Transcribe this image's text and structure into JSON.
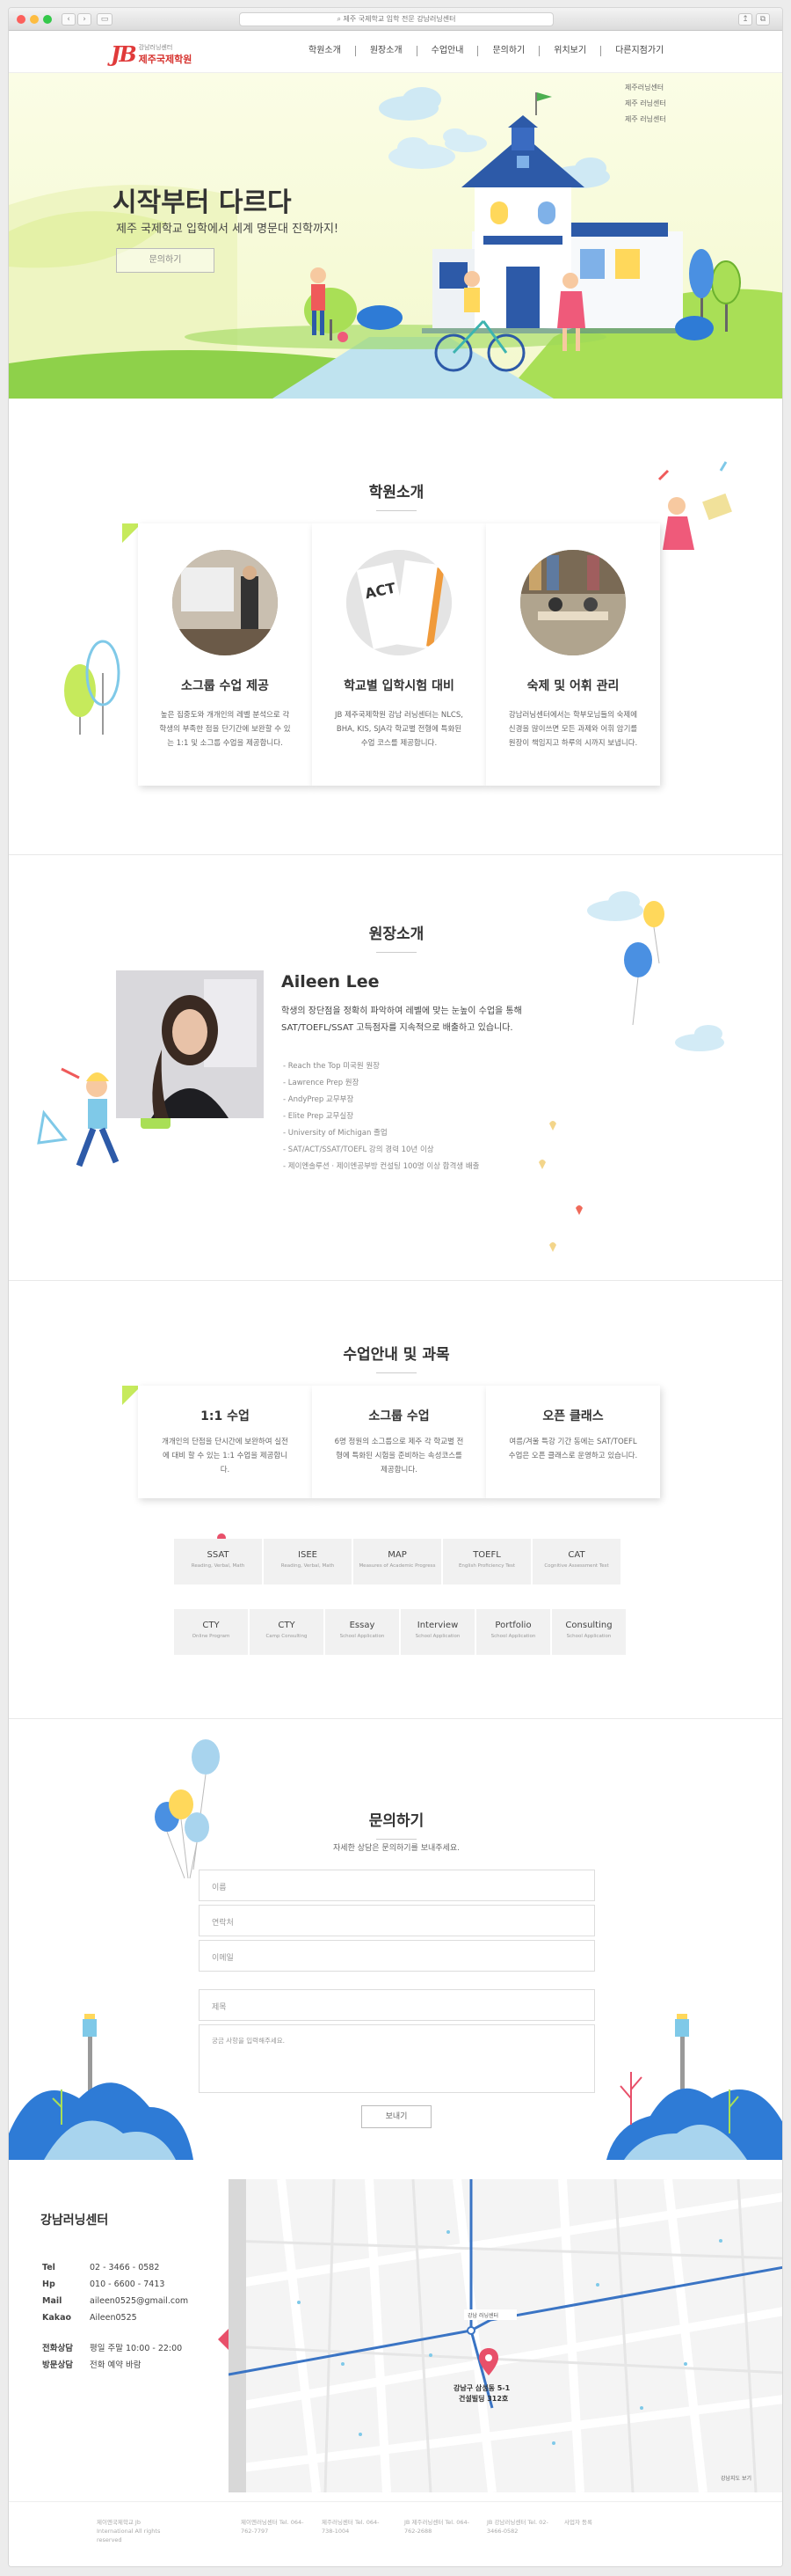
{
  "browser": {
    "address": "제주 국제학교 입학 전문 강남러닝센터"
  },
  "header": {
    "logo_mark": "JB",
    "logo_sub": "강남러닝센터",
    "logo_main": "제주국제학원",
    "nav": [
      "학원소개",
      "원장소개",
      "수업안내",
      "문의하기",
      "위치보기",
      "다른지점가기"
    ]
  },
  "hero": {
    "title": "시작부터 다르다",
    "subtitle": "제주 국제학교 입학에서 세계 명문대 진학까지!",
    "button": "문의하기",
    "side_menu": [
      "제주러닝센터",
      "제주 러닝센터",
      "제주 러닝센터"
    ]
  },
  "intro": {
    "title": "학원소개",
    "cards": [
      {
        "title": "소그룹 수업 제공",
        "desc": "높은 집중도와 개개인의 레벨 분석으로 각 학생의 부족한 점을 단기간에 보완할 수 있는 1:1 및 소그룹 수업을 제공합니다."
      },
      {
        "title": "학교별 입학시험 대비",
        "desc": "JB 제주국제학원 강남 러닝센터는 NLCS, BHA, KIS, SJA각 학교별 전형에 특화된 수업 코스를 제공합니다."
      },
      {
        "title": "숙제 및 어휘 관리",
        "desc": "강남러닝센터에서는 학부모님들의 숙제에 신경을 많이쓰면 모든 과제와 어휘 암기를 원장이 책임지고 하루의 시까지 보냅니다."
      }
    ],
    "act_card": "ACT"
  },
  "director": {
    "title": "원장소개",
    "name": "Aileen Lee",
    "intro": "학생의 장단점을 정확히 파악하여 레벨에 맞는 눈높이 수업을 통해 SAT/TOEFL/SSAT 고득점자를 지속적으로 배출하고 있습니다.",
    "career": [
      "- Reach the Top 미국원 원장",
      "- Lawrence Prep 원장",
      "- AndyPrep 교무부장",
      "- Elite Prep 교무실장",
      "- University of Michigan 졸업",
      "- SAT/ACT/SSAT/TOEFL 강의 경력 10년 이상",
      "- 제이엔솔루션 · 제이엔공부방 컨설팅 100명 이상 합격생 배출"
    ]
  },
  "classes": {
    "title": "수업안내 및 과목",
    "cards": [
      {
        "title": "1:1 수업",
        "desc": "개개인의 단점을 단시간에 보완하여 실전에 대비 할 수 있는 1:1 수업을 제공합니다."
      },
      {
        "title": "소그룹 수업",
        "desc": "6명 정원의 소그룹으로 제주 각 학교별 전형에 특화된 시험을 준비하는 속성코스를 제공합니다."
      },
      {
        "title": "오픈 클래스",
        "desc": "여름/겨울 특강 기간 동에는 SAT/TOEFL 수업은 오픈 클래스로 운영하고 있습니다."
      }
    ],
    "subjects_row1": [
      {
        "name": "SSAT",
        "sub": "Reading, Verbal, Math"
      },
      {
        "name": "ISEE",
        "sub": "Reading, Verbal, Math"
      },
      {
        "name": "MAP",
        "sub": "Measures of Academic Progress"
      },
      {
        "name": "TOEFL",
        "sub": "English Proficiency Test"
      },
      {
        "name": "CAT",
        "sub": "Cognitive Assessment Test"
      }
    ],
    "subjects_row2": [
      {
        "name": "CTY",
        "sub": "Online Program"
      },
      {
        "name": "CTY",
        "sub": "Camp Consulting"
      },
      {
        "name": "Essay",
        "sub": "School Application"
      },
      {
        "name": "Interview",
        "sub": "School Application"
      },
      {
        "name": "Portfolio",
        "sub": "School Application"
      },
      {
        "name": "Consulting",
        "sub": "School Application"
      }
    ]
  },
  "contact": {
    "title": "문의하기",
    "subtitle": "자세한 상담은 문의하기를 보내주세요.",
    "fields": [
      "이름",
      "연락처",
      "이메일",
      "제목"
    ],
    "message_placeholder": "궁금 사항을 입력해주세요.",
    "submit": "보내기"
  },
  "location": {
    "title": "강남러닝센터",
    "rows": [
      {
        "label": "Tel",
        "value": "02 - 3466 - 0582"
      },
      {
        "label": "Hp",
        "value": "010 - 6600 - 7413"
      },
      {
        "label": "Mail",
        "value": "aileen0525@gmail.com"
      },
      {
        "label": "Kakao",
        "value": "Aileen0525"
      }
    ],
    "rows2": [
      {
        "label": "전화상담",
        "value": "평일 주말 10:00 - 22:00"
      },
      {
        "label": "방문상담",
        "value": "전화 예약 바람"
      }
    ],
    "map_label_line1": "강남구 삼성동 5-1",
    "map_label_line2": "건설빌딩 312호",
    "map_pin_label": "강남 러닝센터",
    "map_link": "강남지도 보기"
  },
  "footer": {
    "cols": [
      "제이엔국제학교 Jb International All rights reserved",
      "제이엔러닝센터 Tel. 064-762-7797",
      "제주러닝센터 Tel. 064-738-1004",
      "JB 제주러닝센터 Tel. 064-762-2688",
      "JB 강남러닝센터 Tel. 02-3466-0582",
      "사업자 등록"
    ]
  }
}
